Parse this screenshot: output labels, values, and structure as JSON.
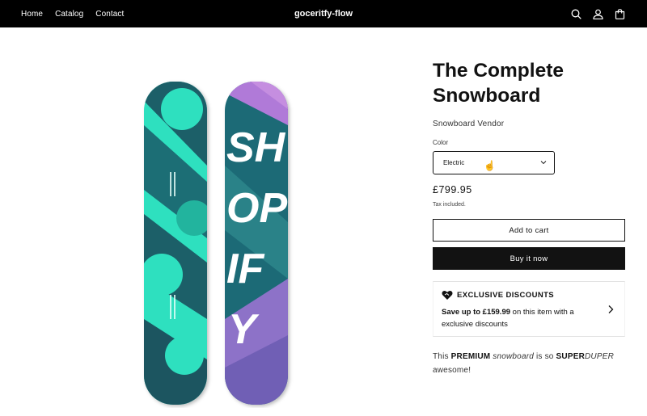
{
  "header": {
    "nav": [
      "Home",
      "Catalog",
      "Contact"
    ],
    "brand": "goceritfy-flow",
    "icons": [
      "search-icon",
      "account-icon",
      "cart-icon"
    ]
  },
  "media": {
    "board_print": "SHOPIFY"
  },
  "product": {
    "title_line1": "The Complete",
    "title_line2": "Snowboard",
    "vendor": "Snowboard Vendor",
    "color_label": "Color",
    "color_value": "Electric",
    "price": "£799.95",
    "tax": "Tax included.",
    "add_to_cart": "Add to cart",
    "buy_now": "Buy it now"
  },
  "discount": {
    "title": "EXCLUSIVE DISCOUNTS",
    "save_text": "Save up to £159.99",
    "rest_text": " on this item with a exclusive discounts"
  },
  "description": {
    "p1": "This ",
    "premium": "PREMIUM",
    "p2": " ",
    "snowboard": "snowboard",
    "p3": " is so ",
    "super": "SUPER",
    "duper": "DUPER",
    "p4": " awesome!"
  },
  "colors": {
    "teal": "#2fe0bf",
    "dark_teal": "#1c5f68",
    "purple": "#a07ad0",
    "black": "#121212"
  }
}
